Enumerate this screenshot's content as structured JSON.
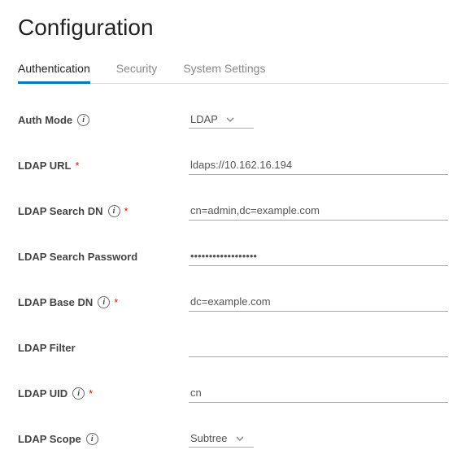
{
  "page_title": "Configuration",
  "tabs": [
    {
      "label": "Authentication",
      "active": true
    },
    {
      "label": "Security",
      "active": false
    },
    {
      "label": "System Settings",
      "active": false
    }
  ],
  "fields": {
    "auth_mode": {
      "label": "Auth Mode",
      "value": "LDAP"
    },
    "ldap_url": {
      "label": "LDAP URL",
      "value": "ldaps://10.162.16.194"
    },
    "ldap_search_dn": {
      "label": "LDAP Search DN",
      "value": "cn=admin,dc=example.com"
    },
    "ldap_search_password": {
      "label": "LDAP Search Password",
      "value": "••••••••••••••••••"
    },
    "ldap_base_dn": {
      "label": "LDAP Base DN",
      "value": "dc=example.com"
    },
    "ldap_filter": {
      "label": "LDAP Filter",
      "value": ""
    },
    "ldap_uid": {
      "label": "LDAP UID",
      "value": "cn"
    },
    "ldap_scope": {
      "label": "LDAP Scope",
      "value": "Subtree"
    }
  },
  "required_marker": "*",
  "info_glyph": "i"
}
